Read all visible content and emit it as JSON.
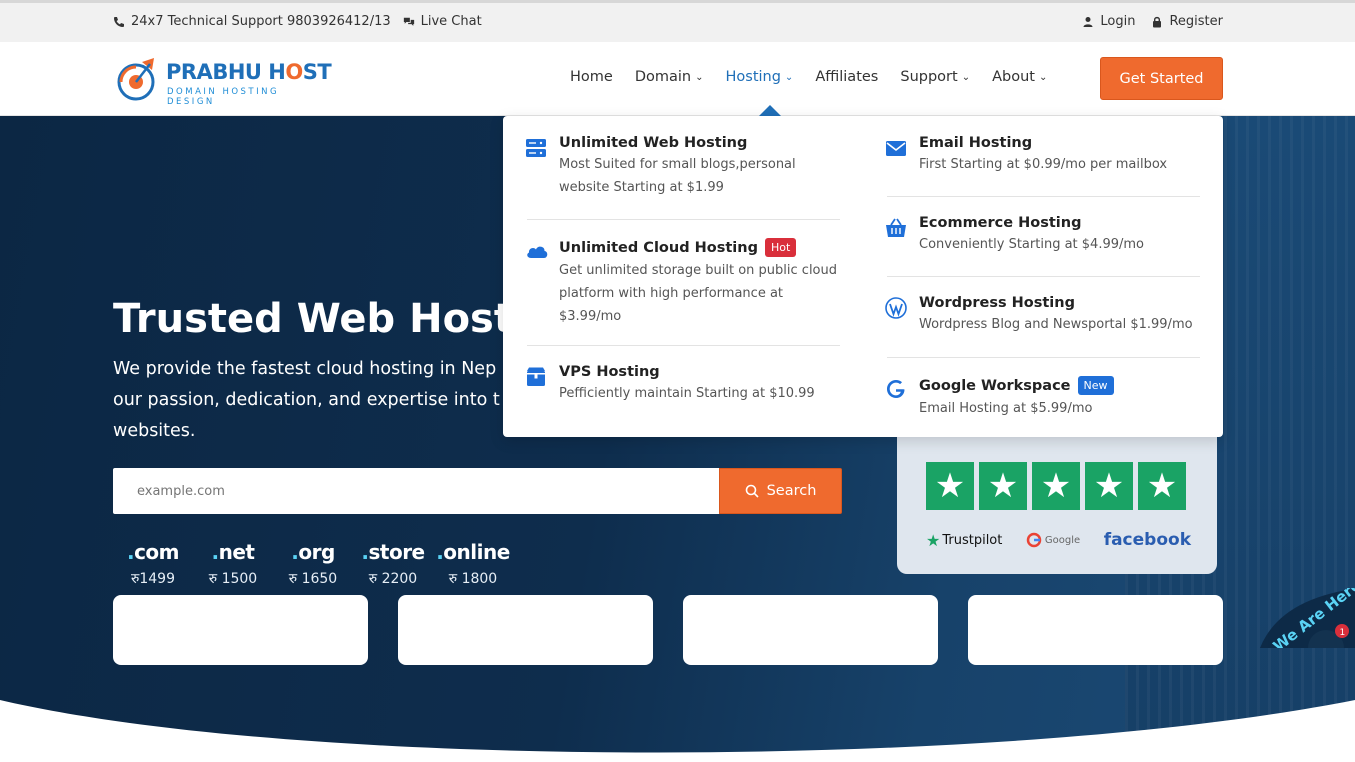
{
  "topbar": {
    "support": "24x7 Technical Support 9803926412/13",
    "live_chat": "Live Chat",
    "login": "Login",
    "register": "Register"
  },
  "brand": {
    "name_part1": "PRABHU H",
    "name_part2": "ST",
    "tagline": "DOMAIN  HOSTING  DESIGN"
  },
  "nav": {
    "items": [
      {
        "label": "Home",
        "dropdown": false
      },
      {
        "label": "Domain",
        "dropdown": true
      },
      {
        "label": "Hosting",
        "dropdown": true
      },
      {
        "label": "Affiliates",
        "dropdown": false
      },
      {
        "label": "Support",
        "dropdown": true
      },
      {
        "label": "About",
        "dropdown": true
      }
    ],
    "active": "Hosting",
    "cta": "Get Started"
  },
  "hero": {
    "title": "Trusted Web Hostin",
    "description": "We provide the fastest cloud hosting in Nep our passion, dedication, and expertise into t websites.",
    "search": {
      "placeholder": "example.com",
      "button": "Search"
    },
    "tlds": [
      {
        "name": "com",
        "price": "रु1499"
      },
      {
        "name": "net",
        "price": "रु 1500"
      },
      {
        "name": "org",
        "price": "रु 1650"
      },
      {
        "name": "store",
        "price": "रु 2200"
      },
      {
        "name": "online",
        "price": "रु 1800"
      }
    ]
  },
  "reviews": {
    "stars": 5,
    "brands": {
      "trustpilot": "Trustpilot",
      "google": "Google",
      "facebook": "facebook"
    }
  },
  "hosting_menu": {
    "left": [
      {
        "icon": "server-icon",
        "title": "Unlimited Web Hosting",
        "tag": "",
        "desc": "Most Suited for small blogs,personal website Starting at $1.99"
      },
      {
        "icon": "cloud-icon",
        "title": "Unlimited Cloud Hosting",
        "tag": "Hot",
        "desc": "Get unlimited storage built on public cloud platform with high performance at $3.99/mo"
      },
      {
        "icon": "box-icon",
        "title": "VPS Hosting",
        "tag": "",
        "desc": "Pefficiently maintain Starting at $10.99"
      }
    ],
    "right": [
      {
        "icon": "mail-icon",
        "title": "Email Hosting",
        "tag": "",
        "desc": "First Starting at $0.99/mo per mailbox"
      },
      {
        "icon": "basket-icon",
        "title": "Ecommerce Hosting",
        "tag": "",
        "desc": "Conveniently Starting at $4.99/mo"
      },
      {
        "icon": "wordpress-icon",
        "title": "Wordpress Hosting",
        "tag": "",
        "desc": "Wordpress Blog and Newsportal $1.99/mo"
      },
      {
        "icon": "google-icon",
        "title": "Google Workspace",
        "tag": "New",
        "desc": "Email Hosting at $5.99/mo"
      }
    ]
  },
  "chat_widget": {
    "text": "We Are Here",
    "badge": "1"
  },
  "colors": {
    "primary": "#1f6fb8",
    "accent": "#ef6a2e",
    "hero": "#0d2a47",
    "trust_green": "#1aa365"
  }
}
